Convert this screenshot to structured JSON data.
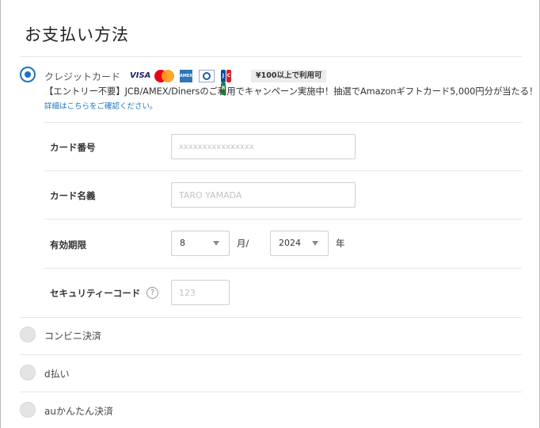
{
  "title": "お支払い方法",
  "credit_card": {
    "label": "クレジットカード",
    "selected": true,
    "brand_logos": [
      "visa-logo",
      "mastercard-logo",
      "amex-logo",
      "diners-logo",
      "jcb-logo"
    ],
    "visa_text": "VISA",
    "amex_text": "AMEX",
    "jcb_letters": [
      "J",
      "C",
      "B"
    ],
    "badge": "¥100以上で利用可",
    "promo": "【エントリー不要】JCB/AMEX/Dinersのご利用でキャンペーン実施中！抽選でAmazonギフトカード5,000円分が当たる！",
    "details_link": "詳細はこちらをご確認ください。",
    "card_number": {
      "label": "カード番号",
      "placeholder": "xxxxxxxxxxxxxxxx",
      "value": ""
    },
    "card_name": {
      "label": "カード名義",
      "placeholder": "TARO YAMADA",
      "value": ""
    },
    "expiry": {
      "label": "有効期限",
      "month": "8",
      "month_unit": "月/",
      "year": "2024",
      "year_unit": "年"
    },
    "security_code": {
      "label": "セキュリティーコード",
      "help_icon_text": "?",
      "placeholder": "123",
      "value": ""
    }
  },
  "other_methods": [
    {
      "label": "コンビニ決済",
      "selected": false
    },
    {
      "label": "d払い",
      "selected": false
    },
    {
      "label": "auかんたん決済",
      "selected": false
    }
  ],
  "colors": {
    "accent": "#1e73be",
    "radio_off": "#e4e4e4",
    "divider": "#e6e6e6",
    "badge_bg": "#ececec"
  }
}
